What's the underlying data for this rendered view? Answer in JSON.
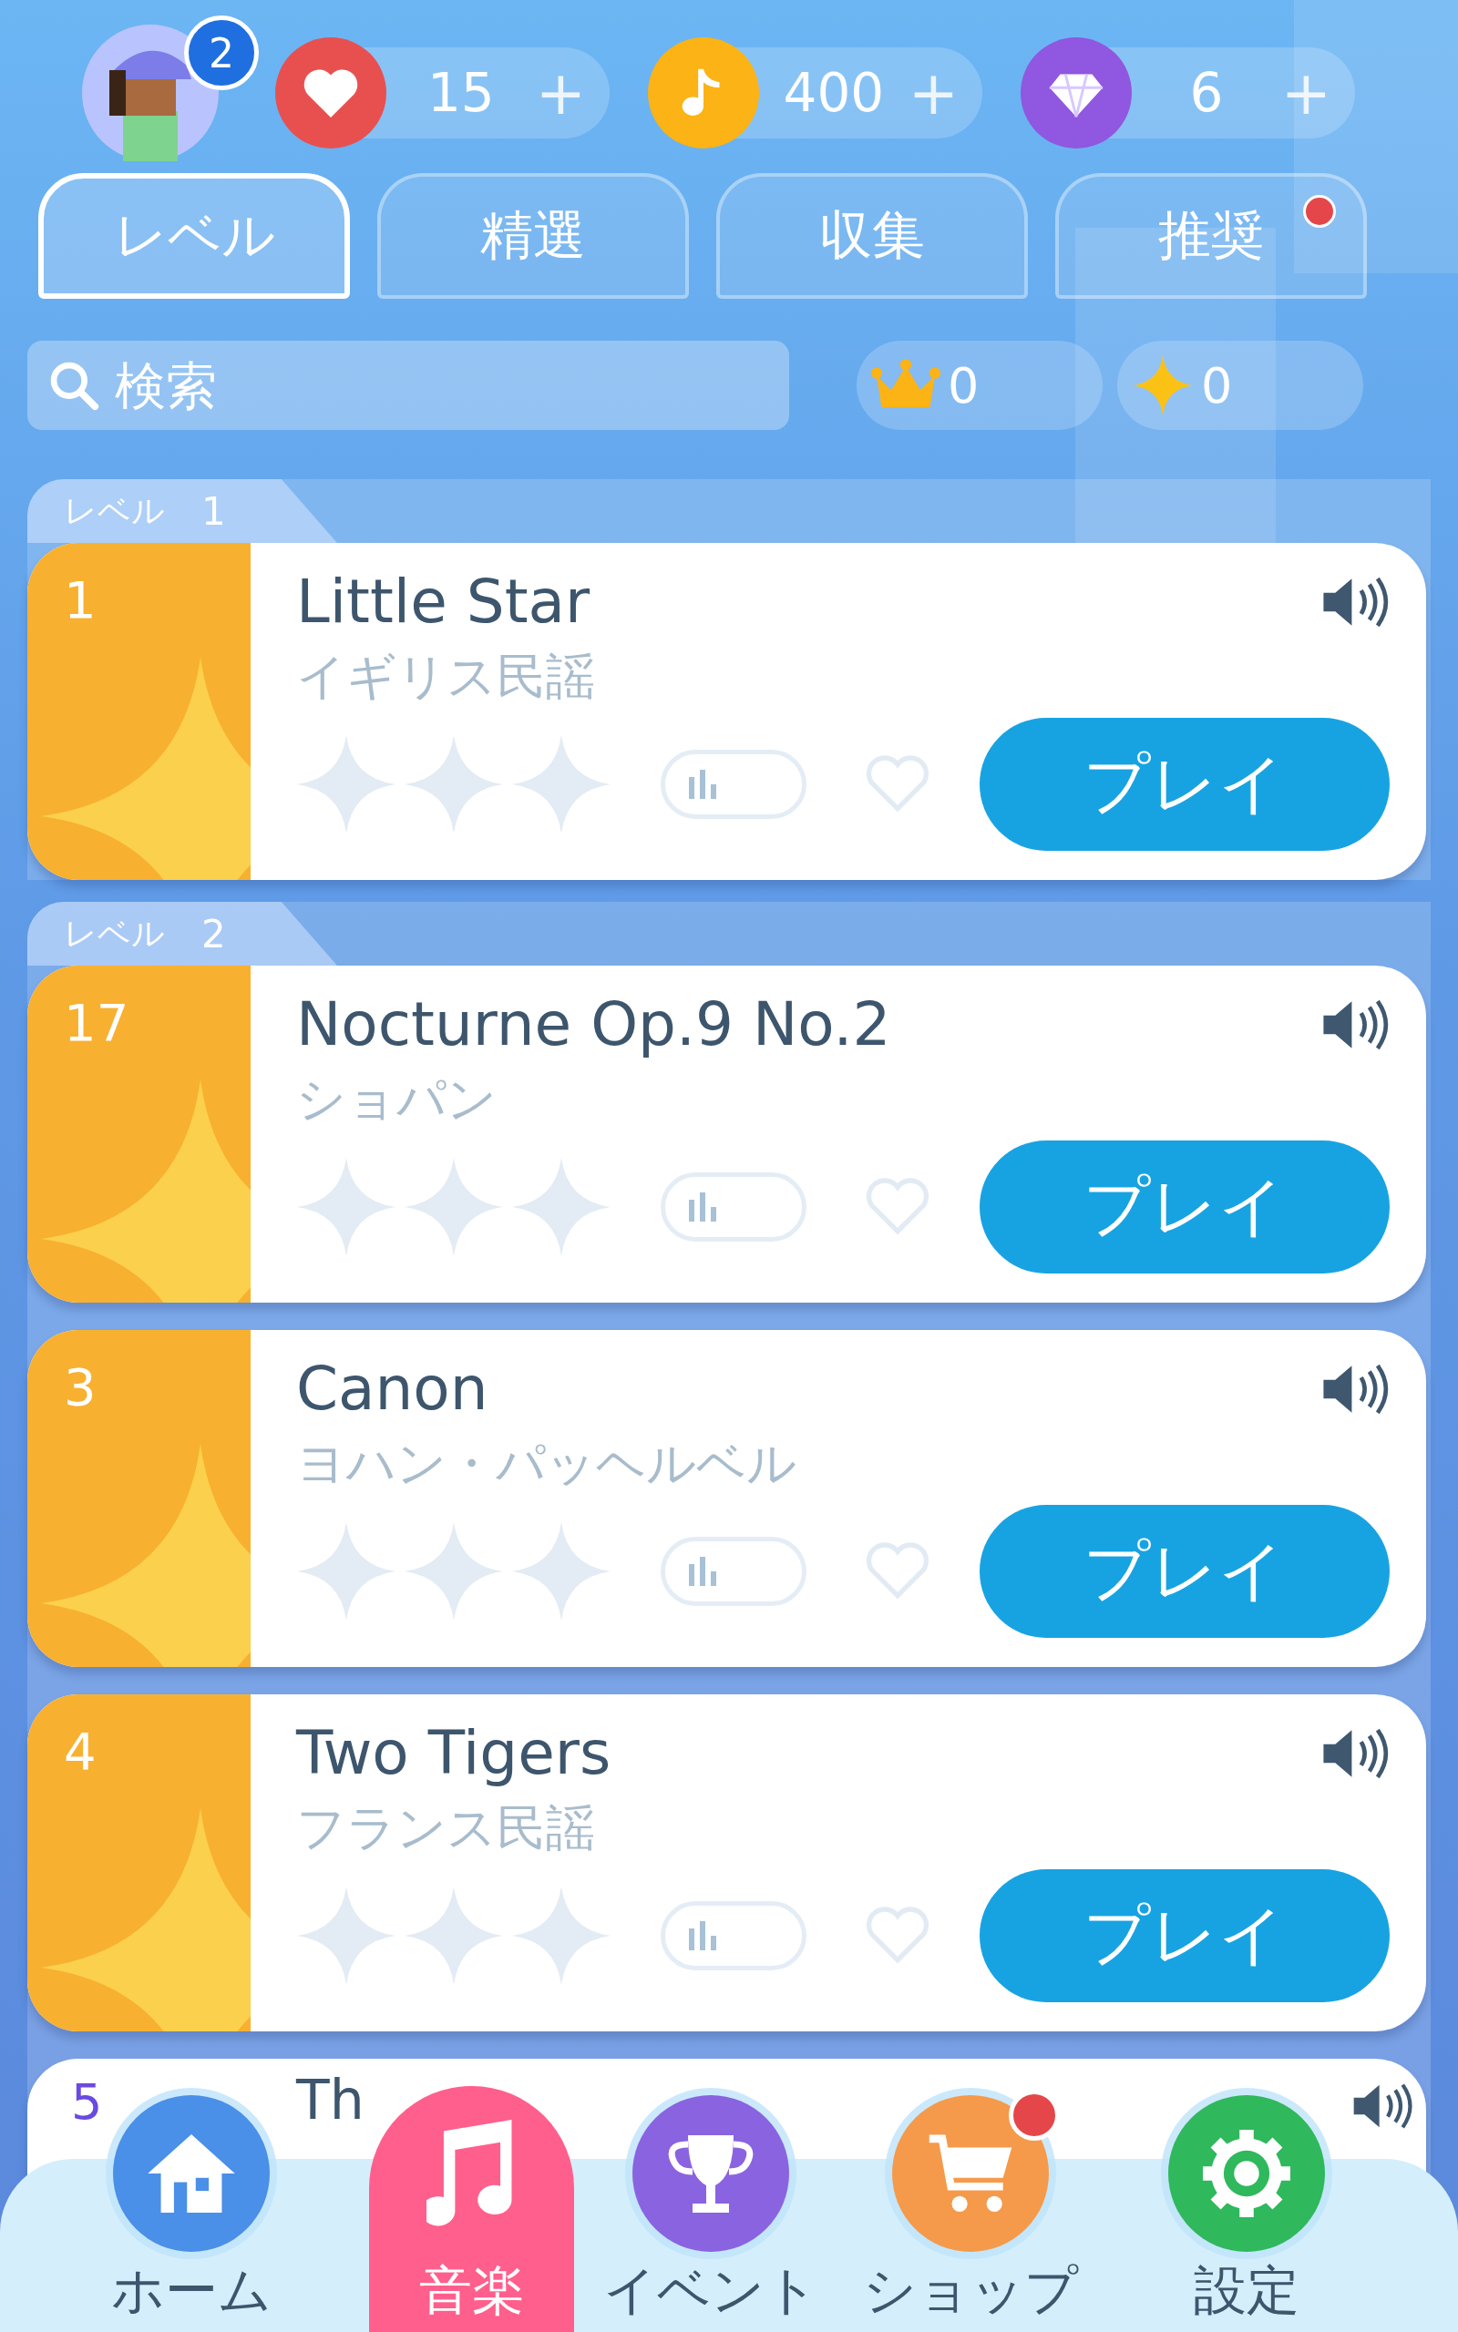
{
  "profile": {
    "badge": "2"
  },
  "currencies": [
    {
      "kind": "heart",
      "value": "15",
      "plus": "+"
    },
    {
      "kind": "note",
      "value": "400",
      "plus": "+"
    },
    {
      "kind": "gem",
      "value": "6",
      "plus": "+"
    }
  ],
  "tabs": [
    {
      "label": "レベル",
      "selected": true,
      "dot": false
    },
    {
      "label": "精選",
      "selected": false,
      "dot": false
    },
    {
      "label": "収集",
      "selected": false,
      "dot": false
    },
    {
      "label": "推奨",
      "selected": false,
      "dot": true
    }
  ],
  "search": {
    "placeholder": "検索"
  },
  "counters": [
    {
      "kind": "crown",
      "value": "0"
    },
    {
      "kind": "sparkle",
      "value": "0"
    }
  ],
  "level_groups": [
    {
      "label": "レベル",
      "number": "1",
      "songs": [
        {
          "kind": "full",
          "number": "1",
          "title": "Little Star",
          "artist": "イギリス民謡",
          "stars": 0,
          "favorited": false,
          "button": "プレイ"
        }
      ]
    },
    {
      "label": "レベル",
      "number": "2",
      "songs": [
        {
          "kind": "full",
          "number": "17",
          "title": "Nocturne Op.9 No.2",
          "artist": "ショパン",
          "stars": 0,
          "favorited": false,
          "button": "プレイ"
        },
        {
          "kind": "full",
          "number": "3",
          "title": "Canon",
          "artist": "ヨハン・パッヘルベル",
          "stars": 0,
          "favorited": false,
          "button": "プレイ"
        },
        {
          "kind": "full",
          "number": "4",
          "title": "Two Tigers",
          "artist": "フランス民謡",
          "stars": 0,
          "favorited": false,
          "button": "プレイ"
        },
        {
          "kind": "partial",
          "number": "5",
          "title": "Th"
        }
      ]
    }
  ],
  "nav": [
    {
      "kind": "home",
      "label": "ホーム",
      "selected": false,
      "badge": false
    },
    {
      "kind": "music",
      "label": "音楽",
      "selected": true,
      "badge": false
    },
    {
      "kind": "trophy",
      "label": "イベント",
      "selected": false,
      "badge": false
    },
    {
      "kind": "cart",
      "label": "ショップ",
      "selected": false,
      "badge": true
    },
    {
      "kind": "gear",
      "label": "設定",
      "selected": false,
      "badge": false
    }
  ]
}
